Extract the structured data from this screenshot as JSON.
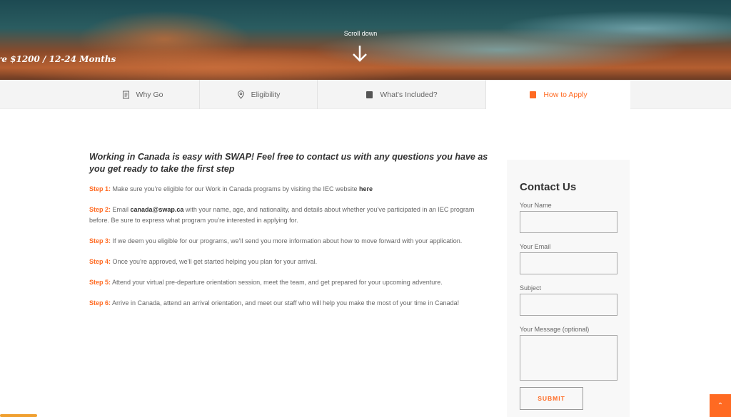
{
  "hero": {
    "tagline": "re $1200 / 12-24 Months",
    "scroll_label": "Scroll down"
  },
  "tabs": [
    {
      "label": "Why Go",
      "icon": "document-icon"
    },
    {
      "label": "Eligibility",
      "icon": "map-pin-icon"
    },
    {
      "label": "What's Included?",
      "icon": "book-icon"
    },
    {
      "label": "How to Apply",
      "icon": "book-icon",
      "active": true
    }
  ],
  "main": {
    "lead": "Working in Canada is easy with SWAP! Feel free to contact us with any questions you have as you get ready to take the first step",
    "steps": [
      {
        "label": "Step 1:",
        "text": " Make sure you’re eligible for our Work in Canada programs by visiting the IEC website ",
        "link": "here"
      },
      {
        "label": "Step 2:",
        "pre": " Email ",
        "email": "canada@swap.ca",
        "text": " with your name, age, and nationality, and details about whether you’ve participated in an IEC program before. Be sure to express what program you’re interested in applying for."
      },
      {
        "label": "Step 3:",
        "text": " If we deem you eligible for our programs, we’ll send you more information about how to move forward with your application."
      },
      {
        "label": "Step 4:",
        "text": " Once you’re approved, we’ll get started helping you plan for your arrival."
      },
      {
        "label": "Step 5:",
        "text": " Attend your virtual pre-departure orientation session, meet the team, and get prepared for your upcoming adventure."
      },
      {
        "label": "Step 6:",
        "text": " Arrive in Canada, attend an arrival orientation, and meet our staff who will help you make the most of your time in Canada!"
      }
    ]
  },
  "contact": {
    "title": "Contact Us",
    "name_label": "Your Name",
    "email_label": "Your Email",
    "subject_label": "Subject",
    "message_label": "Your Message (optional)",
    "submit": "SUBMIT"
  },
  "colors": {
    "accent": "#ff6a22"
  }
}
